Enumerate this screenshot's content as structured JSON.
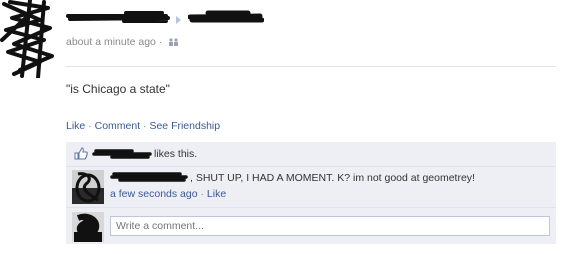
{
  "post": {
    "timestamp": "about a minute ago",
    "separator": "·",
    "privacy_icon": "friends-icon",
    "status": "\"is Chicago a state\""
  },
  "actions": {
    "like": "Like",
    "comment": "Comment",
    "see_friendship": "See Friendship",
    "sep": " · "
  },
  "likes": {
    "icon": "thumbs-up-icon",
    "text": "likes this."
  },
  "comment": {
    "body": ", SHUT UP, I HAD A MOMENT. K? im not good at geometrey!",
    "timestamp": "a few seconds ago",
    "sep": " · ",
    "like": "Like"
  },
  "composer": {
    "placeholder": "Write a comment..."
  },
  "colors": {
    "link": "#3b5998",
    "meta": "#8a8a8a",
    "feedback_bg": "#edeff4"
  }
}
